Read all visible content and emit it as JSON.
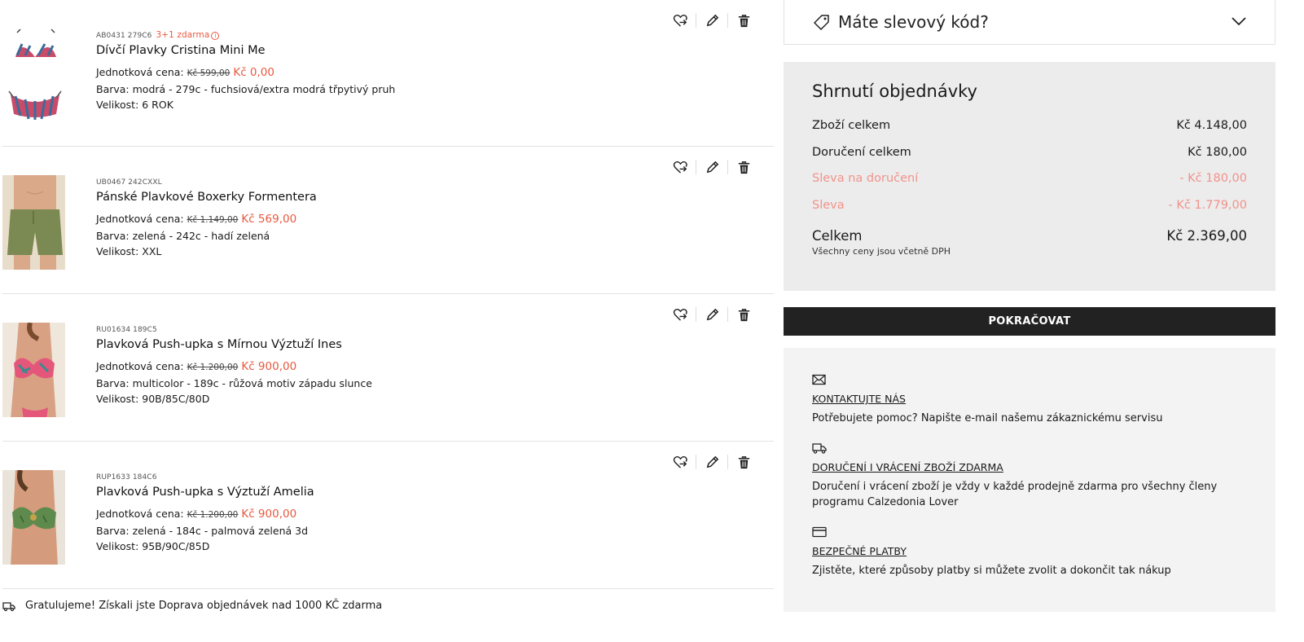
{
  "cart": {
    "items": [
      {
        "sku": "AB0431 279C6",
        "promo": "3+1 zdarma",
        "name": "Dívčí Plavky Cristina Mini Me",
        "unit_label": "Jednotková cena:",
        "old_price": "Kč 599,00",
        "new_price": "Kč 0,00",
        "color": "Barva: modrá - 279c - fuchsiová/extra modrá třpytivý pruh",
        "size": "Velikost: 6 ROK"
      },
      {
        "sku": "UB0467 242CXXL",
        "promo": "",
        "name": "Pánské Plavkové Boxerky Formentera",
        "unit_label": "Jednotková cena:",
        "old_price": "Kč 1.149,00",
        "new_price": "Kč 569,00",
        "color": "Barva: zelená - 242c - hadí zelená",
        "size": "Velikost: XXL"
      },
      {
        "sku": "RU01634 189C5",
        "promo": "",
        "name": "Plavková Push-upka s Mírnou Výztuží Ines",
        "unit_label": "Jednotková cena:",
        "old_price": "Kč 1.200,00",
        "new_price": "Kč 900,00",
        "color": "Barva: multicolor - 189c - růžová motiv západu slunce",
        "size": "Velikost: 90B/85C/80D"
      },
      {
        "sku": "RUP1633 184C6",
        "promo": "",
        "name": "Plavková Push-upka s Výztuží Amelia",
        "unit_label": "Jednotková cena:",
        "old_price": "Kč 1.200,00",
        "new_price": "Kč 900,00",
        "color": "Barva: zelená - 184c - palmová zelená 3d",
        "size": "Velikost: 95B/90C/85D"
      }
    ],
    "icons": [
      "wishlist-heart-icon",
      "edit-pencil-icon",
      "trash-icon"
    ],
    "free_shipping_message": "Gratulujeme! Získali jste Doprava objednávek nad 1000 KČ zdarma"
  },
  "discount": {
    "label": "Máte slevový kód?"
  },
  "summary": {
    "title": "Shrnutí objednávky",
    "rows": [
      {
        "label": "Zboží celkem",
        "value": "Kč 4.148,00"
      },
      {
        "label": "Doručení celkem",
        "value": "Kč 180,00"
      },
      {
        "label": "Sleva na doručení",
        "value": "- Kč 180,00"
      },
      {
        "label": "Sleva",
        "value": "- Kč 1.779,00"
      }
    ],
    "total_label": "Celkem",
    "total_value": "Kč 2.369,00",
    "vat_note": "Všechny ceny jsou včetně DPH"
  },
  "continue_label": "POKRAČOVAT",
  "help": {
    "contact": {
      "title": "KONTAKTUJTE NÁS",
      "text": "Potřebujete pomoc? Napište e-mail našemu zákaznickému servisu"
    },
    "delivery": {
      "title": "DORUČENÍ I VRÁCENÍ ZBOŽÍ ZDARMA",
      "text": "Doručení i vrácení zboží je vždy v každé prodejně zdarma pro všechny členy programu Calzedonia Lover"
    },
    "payment": {
      "title": "BEZPEČNÉ PLATBY",
      "text": "Zjistěte, které způsoby platby si můžete zvolit a dokončit tak nákup"
    }
  },
  "colors": {
    "accent_red": "#e8593f",
    "discount_pink": "#f2928a",
    "button_dark": "#222222",
    "summary_bg": "#ececec",
    "help_bg": "#f3f3f3"
  }
}
